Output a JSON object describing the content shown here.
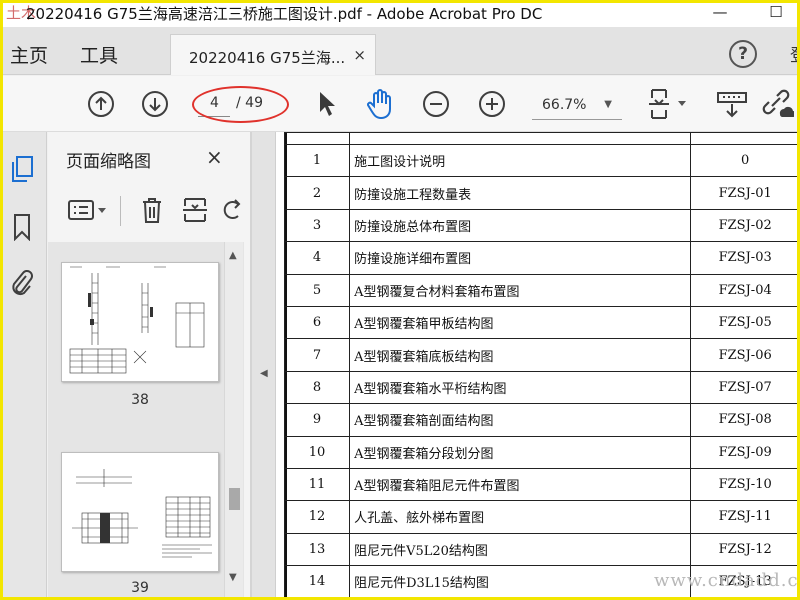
{
  "window": {
    "title": "20220416 G75兰海高速涪江三桥施工图设计.pdf - Adobe Acrobat Pro DC",
    "watermark_logo": "土木在线",
    "controls": {
      "minimize": "—",
      "maximize": "☐"
    }
  },
  "nav": {
    "home_label": "主页",
    "tools_label": "工具",
    "tab_label": "20220416 G75兰海...",
    "tab_close": "×",
    "help_label": "?",
    "signin_partial": "登"
  },
  "toolbar": {
    "current_page": "4",
    "total_pages": "/ 49",
    "zoom": "66.7%",
    "icons": [
      "prev-page-icon",
      "next-page-icon",
      "select-cursor-icon",
      "hand-icon",
      "zoom-out-icon",
      "zoom-in-icon",
      "page-fit-icon",
      "scroll-mode-icon",
      "share-link-icon"
    ]
  },
  "panel": {
    "title": "页面缩略图",
    "close": "×",
    "thumbnails": [
      {
        "page": "38"
      },
      {
        "page": "39"
      }
    ]
  },
  "document": {
    "rows": [
      {
        "n": "1",
        "name": "施工图设计说明",
        "code": "0"
      },
      {
        "n": "2",
        "name": "防撞设施工程数量表",
        "code": "FZSJ-01"
      },
      {
        "n": "3",
        "name": "防撞设施总体布置图",
        "code": "FZSJ-02"
      },
      {
        "n": "4",
        "name": "防撞设施详细布置图",
        "code": "FZSJ-03"
      },
      {
        "n": "5",
        "name": "A型钢覆复合材料套箱布置图",
        "code": "FZSJ-04"
      },
      {
        "n": "6",
        "name": "A型钢覆套箱甲板结构图",
        "code": "FZSJ-05"
      },
      {
        "n": "7",
        "name": "A型钢覆套箱底板结构图",
        "code": "FZSJ-06"
      },
      {
        "n": "8",
        "name": "A型钢覆套箱水平桁结构图",
        "code": "FZSJ-07"
      },
      {
        "n": "9",
        "name": "A型钢覆套箱剖面结构图",
        "code": "FZSJ-08"
      },
      {
        "n": "10",
        "name": "A型钢覆套箱分段划分图",
        "code": "FZSJ-09"
      },
      {
        "n": "11",
        "name": "A型钢覆套箱阻尼元件布置图",
        "code": "FZSJ-10"
      },
      {
        "n": "12",
        "name": "人孔盖、舷外梯布置图",
        "code": "FZSJ-11"
      },
      {
        "n": "13",
        "name": "阻尼元件V5L20结构图",
        "code": "FZSJ-12"
      },
      {
        "n": "14",
        "name": "阻尼元件D3L15结构图",
        "code": "FZSJ-13"
      }
    ]
  },
  "watermark_text": "www.cndadd.com"
}
